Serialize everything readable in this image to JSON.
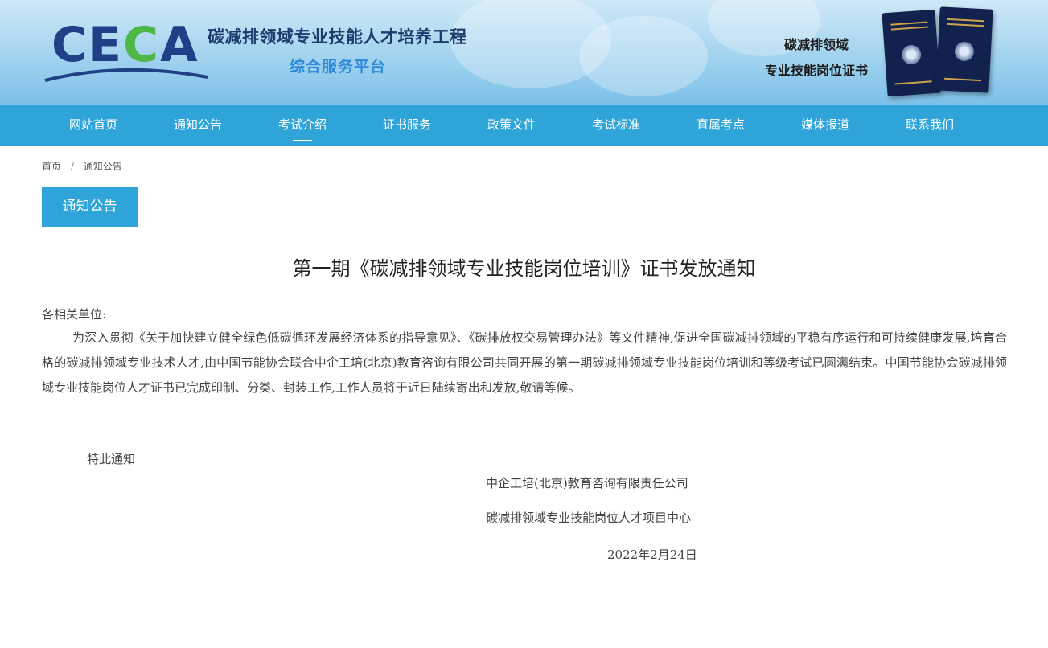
{
  "header": {
    "logo_text_1": "CE",
    "logo_text_2": "C",
    "logo_text_3": "A",
    "project_title": "碳减排领域专业技能人才培养工程",
    "project_subtitle": "综合服务平台",
    "cert_label_line1": "碳减排领域",
    "cert_label_line2": "专业技能岗位证书"
  },
  "nav": {
    "items": [
      {
        "label": "网站首页"
      },
      {
        "label": "通知公告"
      },
      {
        "label": "考试介绍"
      },
      {
        "label": "证书服务"
      },
      {
        "label": "政策文件"
      },
      {
        "label": "考试标准"
      },
      {
        "label": "直属考点"
      },
      {
        "label": "媒体报道"
      },
      {
        "label": "联系我们"
      }
    ],
    "active_index": 2
  },
  "breadcrumb": {
    "home": "首页",
    "separator": "/",
    "current": "通知公告"
  },
  "section_tab": "通知公告",
  "article": {
    "title": "第一期《碳减排领域专业技能岗位培训》证书发放通知",
    "salutation": "各相关单位:",
    "body": "为深入贯彻《关于加快建立健全绿色低碳循环发展经济体系的指导意见》、《碳排放权交易管理办法》等文件精神,促进全国碳减排领域的平稳有序运行和可持续健康发展,培育合格的碳减排领域专业技术人才,由中国节能协会联合中企工培(北京)教育咨询有限公司共同开展的第一期碳减排领域专业技能岗位培训和等级考试已圆满结束。中国节能协会碳减排领域专业技能岗位人才证书已完成印制、分类、封装工作,工作人员将于近日陆续寄出和发放,敬请等候。",
    "closing": "特此通知",
    "signatory_1": "中企工培(北京)教育咨询有限责任公司",
    "signatory_2": "碳减排领域专业技能岗位人才项目中心",
    "date": "2022年2月24日"
  },
  "colors": {
    "nav_bg": "#2ea4d9",
    "logo_blue": "#1f3f86",
    "logo_green": "#4fb648",
    "subtitle_blue": "#2f8ad6"
  }
}
